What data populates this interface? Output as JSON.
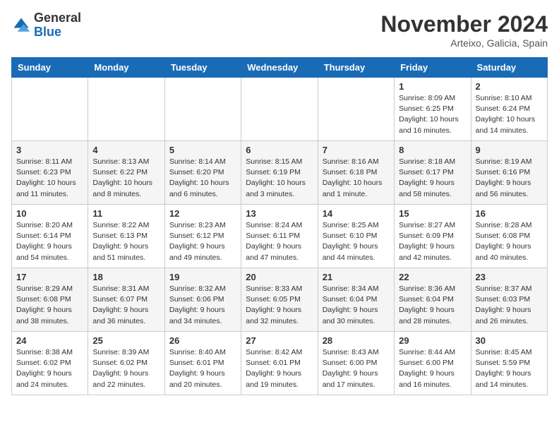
{
  "header": {
    "logo_general": "General",
    "logo_blue": "Blue",
    "month_title": "November 2024",
    "location": "Arteixo, Galicia, Spain"
  },
  "weekdays": [
    "Sunday",
    "Monday",
    "Tuesday",
    "Wednesday",
    "Thursday",
    "Friday",
    "Saturday"
  ],
  "weeks": [
    [
      {
        "day": "",
        "info": ""
      },
      {
        "day": "",
        "info": ""
      },
      {
        "day": "",
        "info": ""
      },
      {
        "day": "",
        "info": ""
      },
      {
        "day": "",
        "info": ""
      },
      {
        "day": "1",
        "info": "Sunrise: 8:09 AM\nSunset: 6:25 PM\nDaylight: 10 hours and 16 minutes."
      },
      {
        "day": "2",
        "info": "Sunrise: 8:10 AM\nSunset: 6:24 PM\nDaylight: 10 hours and 14 minutes."
      }
    ],
    [
      {
        "day": "3",
        "info": "Sunrise: 8:11 AM\nSunset: 6:23 PM\nDaylight: 10 hours and 11 minutes."
      },
      {
        "day": "4",
        "info": "Sunrise: 8:13 AM\nSunset: 6:22 PM\nDaylight: 10 hours and 8 minutes."
      },
      {
        "day": "5",
        "info": "Sunrise: 8:14 AM\nSunset: 6:20 PM\nDaylight: 10 hours and 6 minutes."
      },
      {
        "day": "6",
        "info": "Sunrise: 8:15 AM\nSunset: 6:19 PM\nDaylight: 10 hours and 3 minutes."
      },
      {
        "day": "7",
        "info": "Sunrise: 8:16 AM\nSunset: 6:18 PM\nDaylight: 10 hours and 1 minute."
      },
      {
        "day": "8",
        "info": "Sunrise: 8:18 AM\nSunset: 6:17 PM\nDaylight: 9 hours and 58 minutes."
      },
      {
        "day": "9",
        "info": "Sunrise: 8:19 AM\nSunset: 6:16 PM\nDaylight: 9 hours and 56 minutes."
      }
    ],
    [
      {
        "day": "10",
        "info": "Sunrise: 8:20 AM\nSunset: 6:14 PM\nDaylight: 9 hours and 54 minutes."
      },
      {
        "day": "11",
        "info": "Sunrise: 8:22 AM\nSunset: 6:13 PM\nDaylight: 9 hours and 51 minutes."
      },
      {
        "day": "12",
        "info": "Sunrise: 8:23 AM\nSunset: 6:12 PM\nDaylight: 9 hours and 49 minutes."
      },
      {
        "day": "13",
        "info": "Sunrise: 8:24 AM\nSunset: 6:11 PM\nDaylight: 9 hours and 47 minutes."
      },
      {
        "day": "14",
        "info": "Sunrise: 8:25 AM\nSunset: 6:10 PM\nDaylight: 9 hours and 44 minutes."
      },
      {
        "day": "15",
        "info": "Sunrise: 8:27 AM\nSunset: 6:09 PM\nDaylight: 9 hours and 42 minutes."
      },
      {
        "day": "16",
        "info": "Sunrise: 8:28 AM\nSunset: 6:08 PM\nDaylight: 9 hours and 40 minutes."
      }
    ],
    [
      {
        "day": "17",
        "info": "Sunrise: 8:29 AM\nSunset: 6:08 PM\nDaylight: 9 hours and 38 minutes."
      },
      {
        "day": "18",
        "info": "Sunrise: 8:31 AM\nSunset: 6:07 PM\nDaylight: 9 hours and 36 minutes."
      },
      {
        "day": "19",
        "info": "Sunrise: 8:32 AM\nSunset: 6:06 PM\nDaylight: 9 hours and 34 minutes."
      },
      {
        "day": "20",
        "info": "Sunrise: 8:33 AM\nSunset: 6:05 PM\nDaylight: 9 hours and 32 minutes."
      },
      {
        "day": "21",
        "info": "Sunrise: 8:34 AM\nSunset: 6:04 PM\nDaylight: 9 hours and 30 minutes."
      },
      {
        "day": "22",
        "info": "Sunrise: 8:36 AM\nSunset: 6:04 PM\nDaylight: 9 hours and 28 minutes."
      },
      {
        "day": "23",
        "info": "Sunrise: 8:37 AM\nSunset: 6:03 PM\nDaylight: 9 hours and 26 minutes."
      }
    ],
    [
      {
        "day": "24",
        "info": "Sunrise: 8:38 AM\nSunset: 6:02 PM\nDaylight: 9 hours and 24 minutes."
      },
      {
        "day": "25",
        "info": "Sunrise: 8:39 AM\nSunset: 6:02 PM\nDaylight: 9 hours and 22 minutes."
      },
      {
        "day": "26",
        "info": "Sunrise: 8:40 AM\nSunset: 6:01 PM\nDaylight: 9 hours and 20 minutes."
      },
      {
        "day": "27",
        "info": "Sunrise: 8:42 AM\nSunset: 6:01 PM\nDaylight: 9 hours and 19 minutes."
      },
      {
        "day": "28",
        "info": "Sunrise: 8:43 AM\nSunset: 6:00 PM\nDaylight: 9 hours and 17 minutes."
      },
      {
        "day": "29",
        "info": "Sunrise: 8:44 AM\nSunset: 6:00 PM\nDaylight: 9 hours and 16 minutes."
      },
      {
        "day": "30",
        "info": "Sunrise: 8:45 AM\nSunset: 5:59 PM\nDaylight: 9 hours and 14 minutes."
      }
    ]
  ]
}
